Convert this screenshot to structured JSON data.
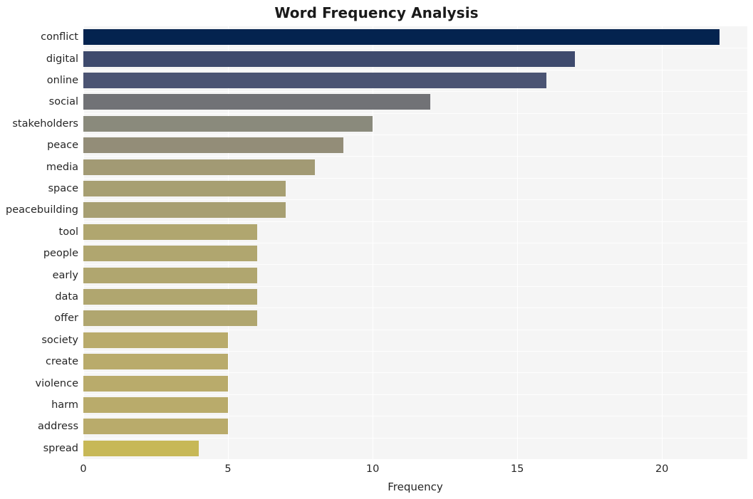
{
  "chart_data": {
    "type": "bar",
    "orientation": "horizontal",
    "title": "Word Frequency Analysis",
    "xlabel": "Frequency",
    "ylabel": "",
    "categories": [
      "conflict",
      "digital",
      "online",
      "social",
      "stakeholders",
      "peace",
      "media",
      "space",
      "peacebuilding",
      "tool",
      "people",
      "early",
      "data",
      "offer",
      "society",
      "create",
      "violence",
      "harm",
      "address",
      "spread"
    ],
    "values": [
      22,
      17,
      16,
      12,
      10,
      9,
      8,
      7,
      7,
      6,
      6,
      6,
      6,
      6,
      5,
      5,
      5,
      5,
      5,
      4
    ],
    "bar_colors": [
      "#04234f",
      "#3e4a6d",
      "#4b5473",
      "#717276",
      "#8a8a7c",
      "#938d78",
      "#a29a74",
      "#a79f72",
      "#a79f72",
      "#b0a66f",
      "#b0a66f",
      "#b0a66f",
      "#b0a66f",
      "#b0a66f",
      "#b9ab6b",
      "#b9ab6b",
      "#b9ab6b",
      "#b9ab6b",
      "#b9ab6b",
      "#c7b857"
    ],
    "xticks": [
      0,
      5,
      10,
      15,
      20
    ],
    "xtick_labels": [
      "0",
      "5",
      "10",
      "15",
      "20"
    ],
    "xlim": [
      0,
      22.95
    ],
    "grid": true,
    "grid_color": "#ffffff",
    "plot_background": "#f5f5f5",
    "figure_background": "#ffffff",
    "legend": null
  }
}
